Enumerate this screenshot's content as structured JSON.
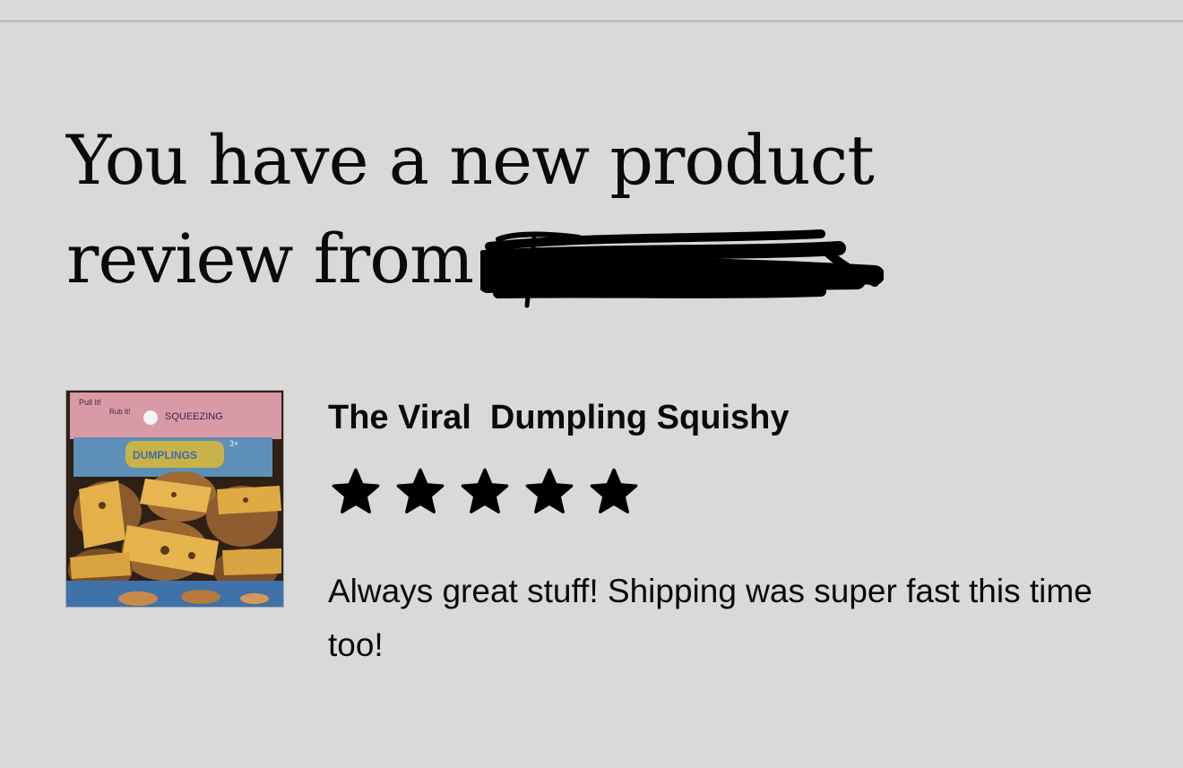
{
  "email": {
    "headline_line1": "You have a new product",
    "headline_line2": "review from",
    "headline_redacted": true
  },
  "review": {
    "product_name": "The Viral  Dumpling Squishy",
    "rating": 5,
    "rating_max": 5,
    "text": "Always great stuff! Shipping was super fast this time too!"
  },
  "product_image": {
    "label_top_1": "Pull It!",
    "label_top_2": "Rub It!",
    "label_brand": "SQUEEZING",
    "label_product": "DUMPLINGS",
    "label_age": "3+"
  },
  "colors": {
    "background": "#d9d9d9",
    "text": "#0a0a0a",
    "star": "#000000",
    "rule": "#bdbdbd"
  }
}
